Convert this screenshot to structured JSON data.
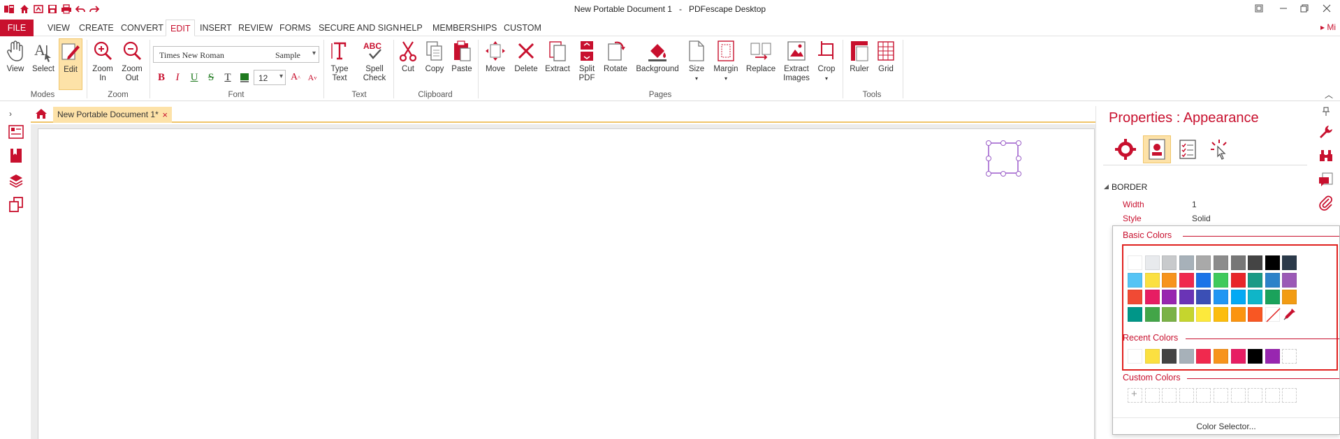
{
  "window": {
    "title": "New Portable Document 1",
    "separator": "-",
    "app_name": "PDFescape Desktop"
  },
  "quick_access": [
    "app-logo-icon",
    "home-icon",
    "open-icon",
    "save-icon",
    "print-icon",
    "undo-icon",
    "redo-icon"
  ],
  "menu": {
    "file": "FILE",
    "tabs": [
      "VIEW",
      "CREATE",
      "CONVERT",
      "EDIT",
      "INSERT",
      "REVIEW",
      "FORMS",
      "SECURE AND SIGN",
      "HELP",
      "MEMBERSHIPS",
      "CUSTOM"
    ],
    "active": "EDIT",
    "user": "Mi"
  },
  "ribbon": {
    "groups": {
      "modes": "Modes",
      "zoom": "Zoom",
      "font": "Font",
      "text": "Text",
      "clipboard": "Clipboard",
      "pages": "Pages",
      "tools": "Tools"
    },
    "buttons": {
      "view": "View",
      "select": "Select",
      "edit": "Edit",
      "zoom_in_1": "Zoom",
      "zoom_in_2": "In",
      "zoom_out_1": "Zoom",
      "zoom_out_2": "Out",
      "type_text_1": "Type",
      "type_text_2": "Text",
      "spell_check_1": "Spell",
      "spell_check_2": "Check",
      "cut": "Cut",
      "copy": "Copy",
      "paste": "Paste",
      "move": "Move",
      "delete": "Delete",
      "extract": "Extract",
      "split_pdf_1": "Split",
      "split_pdf_2": "PDF",
      "rotate": "Rotate",
      "background": "Background",
      "size": "Size",
      "margin": "Margin",
      "replace": "Replace",
      "extract_images_1": "Extract",
      "extract_images_2": "Images",
      "crop": "Crop",
      "ruler": "Ruler",
      "grid": "Grid"
    },
    "font": {
      "name": "Times New Roman",
      "sample": "Sample",
      "size": "12",
      "bold": "B",
      "italic": "I",
      "underline": "U",
      "strike": "S",
      "text_color": "T",
      "fill_color": "#1f7a1f",
      "grow": "A",
      "shrink": "A"
    }
  },
  "doc_tab": {
    "label": "New Portable Document 1*",
    "close": "×"
  },
  "properties": {
    "title": "Properties : Appearance",
    "section": "BORDER",
    "rows": [
      {
        "label": "Width",
        "value": "1"
      },
      {
        "label": "Style",
        "value": "Solid"
      }
    ]
  },
  "color_popup": {
    "basic_label": "Basic Colors",
    "recent_label": "Recent Colors",
    "custom_label": "Custom Colors",
    "footer": "Color Selector...",
    "basic": [
      [
        "#ffffff",
        "#e8eaed",
        "#c8cacc",
        "#a7b1b9",
        "#a9a9a9",
        "#8c8c8c",
        "#777777",
        "#444444",
        "#000000",
        "#2b3a4a"
      ],
      [
        "#55c4f5",
        "#fbe040",
        "#f7941d",
        "#f0294e",
        "#1b74e8",
        "#3fca5c",
        "#e8262a",
        "#1a9a86",
        "#2c82c9",
        "#9b59b6"
      ],
      [
        "#f04a34",
        "#e71d63",
        "#9826b0",
        "#6a34b6",
        "#3b4fb5",
        "#2196f3",
        "#03a9f4",
        "#0fb5c8",
        "#1aa25b",
        "#f29c13"
      ],
      [
        "#009688",
        "#43a548",
        "#7bb247",
        "#c5d52e",
        "#fde93c",
        "#fcbd0d",
        "#fb9410",
        "#f85723",
        "none",
        "eyedropper"
      ]
    ],
    "recent": [
      "#ffffff",
      "#fbe040",
      "#444444",
      "#a7b1b9",
      "#f0294e",
      "#f7941d",
      "#e71d63",
      "#000000",
      "#9826b0",
      "empty"
    ],
    "custom_count": 10,
    "accent": "#c8102e",
    "frame_color": "#e0201e"
  }
}
